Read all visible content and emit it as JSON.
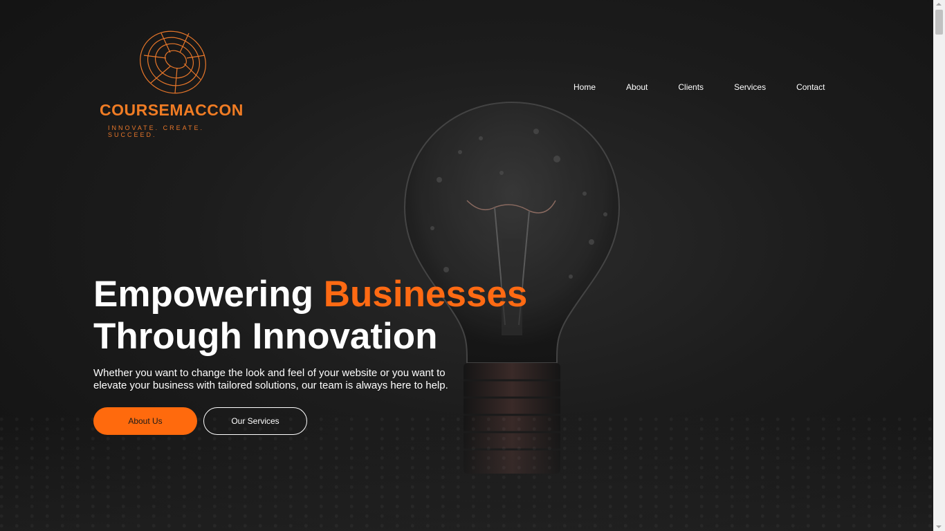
{
  "brand": {
    "name": "COURSEMACCON",
    "tagline": "INNOVATE. CREATE. SUCCEED.",
    "color": "#f07c24"
  },
  "nav": {
    "items": [
      "Home",
      "About",
      "Clients",
      "Services",
      "Contact"
    ]
  },
  "hero": {
    "title_line1_prefix": "Empowering",
    "title_line1_accent": "Businesses",
    "title_line2": "Through Innovation",
    "description": "Whether you want to change the look and feel of your website or you want to elevate your business with tailored solutions, our team is always here to help.",
    "primary_button": "About Us",
    "secondary_button": "Our Services",
    "accent_color": "#ff6a13"
  }
}
